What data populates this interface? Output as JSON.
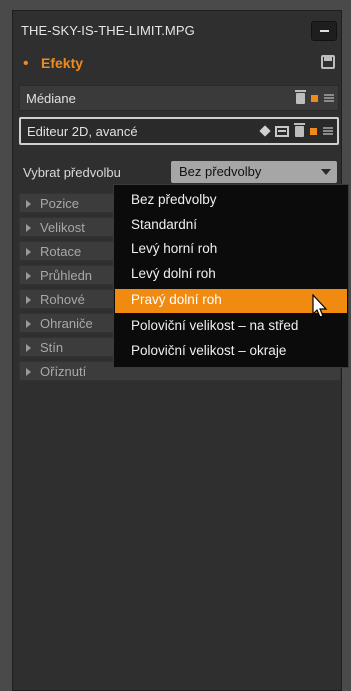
{
  "window": {
    "title": "THE-SKY-IS-THE-LIMIT.MPG"
  },
  "effects": {
    "label": "Efekty"
  },
  "effect_rows": [
    {
      "label": "Médiane"
    },
    {
      "label": "Editeur 2D, avancé"
    }
  ],
  "preset": {
    "label": "Vybrat předvolbu",
    "value": "Bez předvolby"
  },
  "sections": [
    {
      "label": "Pozice"
    },
    {
      "label": "Velikost"
    },
    {
      "label": "Rotace"
    },
    {
      "label": "Průhledn"
    },
    {
      "label": "Rohové"
    },
    {
      "label": "Ohraniče"
    },
    {
      "label": "Stín"
    },
    {
      "label": "Oříznutí"
    }
  ],
  "dropdown": {
    "options": [
      "Bez předvolby",
      "Standardní",
      "Levý horní roh",
      "Levý dolní roh",
      "Pravý dolní roh",
      "Poloviční velikost – na střed",
      "Poloviční velikost – okraje"
    ],
    "highlighted": "Pravý dolní roh"
  },
  "colors": {
    "accent": "#f08a10",
    "panel": "#2f2f2f",
    "background": "#4a4a4a"
  },
  "icons": [
    "minimize-icon",
    "save-icon",
    "trash-icon",
    "orange-square-icon",
    "hamburger-icon",
    "keyframe-diamond-icon",
    "panel-icon",
    "mouse-cursor-icon"
  ]
}
